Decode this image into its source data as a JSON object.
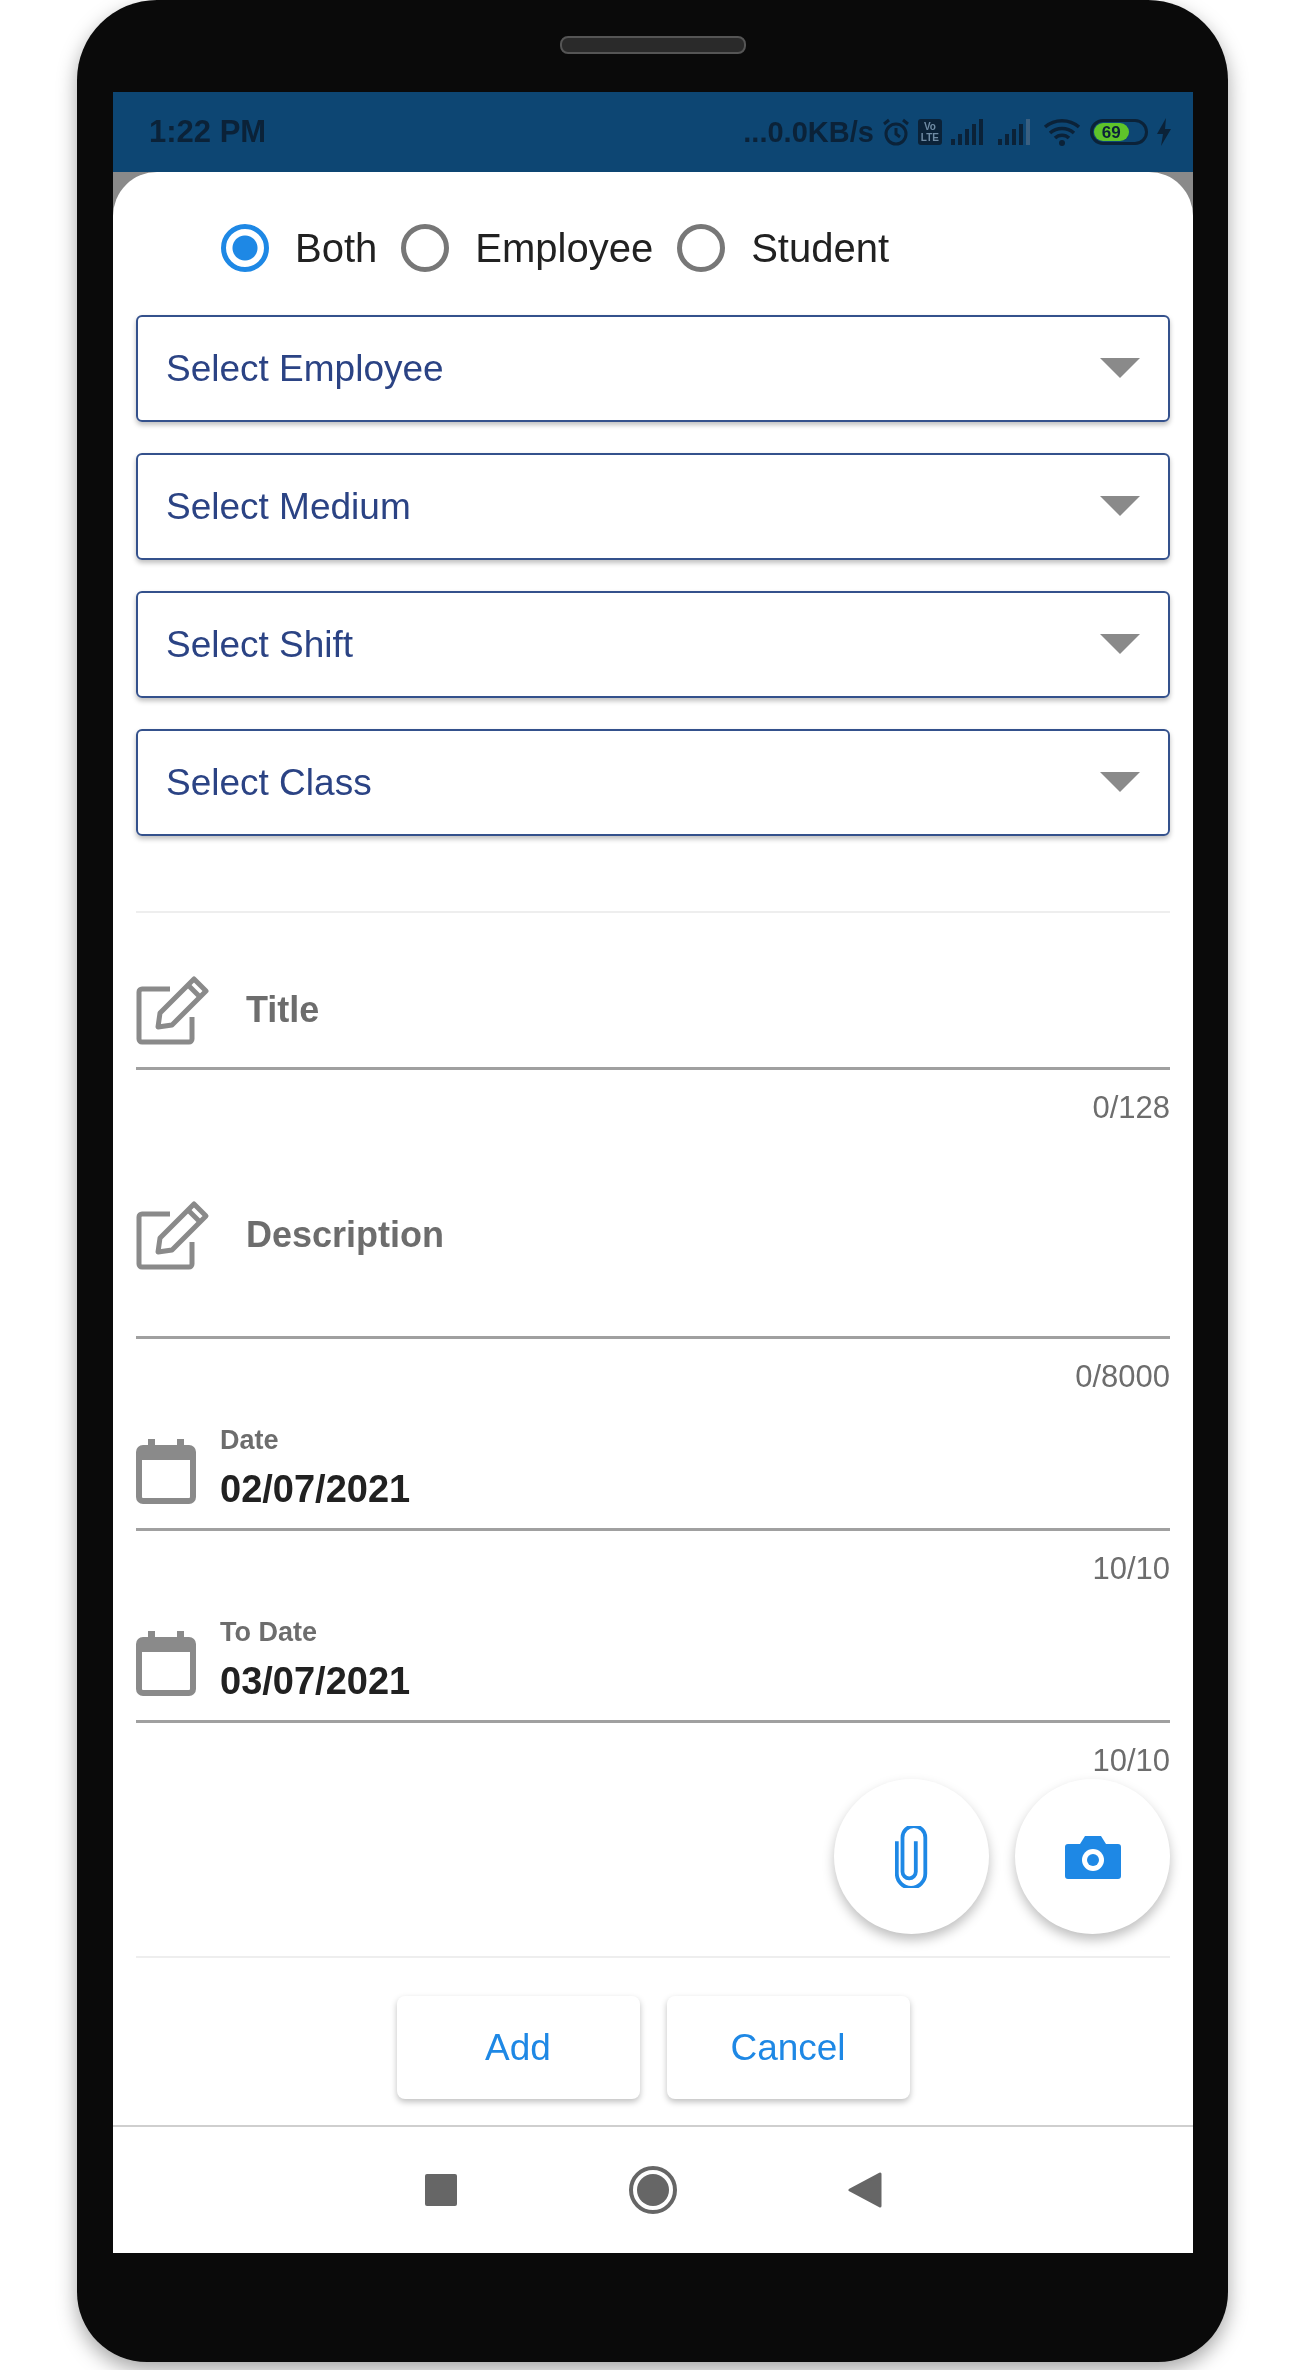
{
  "status_bar": {
    "time": "1:22 PM",
    "network_speed": "...0.0KB/s",
    "volte_lines": [
      "Vo",
      "LTE"
    ],
    "battery": "69"
  },
  "recipient_type": [
    {
      "label": "Both",
      "selected": true
    },
    {
      "label": "Employee",
      "selected": false
    },
    {
      "label": "Student",
      "selected": false
    }
  ],
  "dropdowns": [
    {
      "placeholder": "Select Employee"
    },
    {
      "placeholder": "Select Medium"
    },
    {
      "placeholder": "Select Shift"
    },
    {
      "placeholder": "Select Class"
    }
  ],
  "fields": [
    {
      "kind": "text",
      "label": "Title",
      "counter": "0/128"
    },
    {
      "kind": "multiline",
      "label": "Description",
      "counter": "0/8000"
    },
    {
      "kind": "date",
      "label": "Date",
      "value": "02/07/2021",
      "counter": "10/10"
    },
    {
      "kind": "date",
      "label": "To Date",
      "value": "03/07/2021",
      "counter": "10/10"
    }
  ],
  "buttons": [
    "Add",
    "Cancel"
  ]
}
